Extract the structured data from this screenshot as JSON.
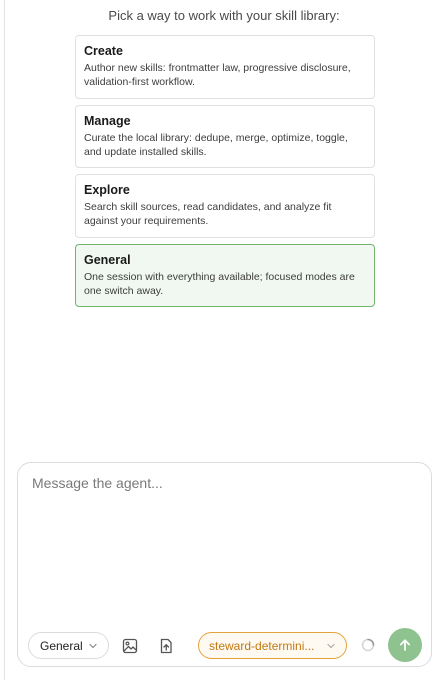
{
  "prompt": "Pick a way to work with your skill library:",
  "modes": [
    {
      "title": "Create",
      "description": "Author new skills: frontmatter law, progressive disclosure, validation-first workflow."
    },
    {
      "title": "Manage",
      "description": "Curate the local library: dedupe, merge, optimize, toggle, and update installed skills."
    },
    {
      "title": "Explore",
      "description": "Search skill sources, read candidates, and analyze fit against your requirements."
    },
    {
      "title": "General",
      "description": "One session with everything available; focused modes are one switch away."
    }
  ],
  "selected_mode": "General",
  "composer": {
    "placeholder": "Message the agent...",
    "value": "",
    "mode_label": "General",
    "model_label": "steward-determini..."
  },
  "icons": {
    "mode_chevron": "chevron-down-icon",
    "image": "image-icon",
    "upload": "file-upload-icon",
    "model_chevron": "chevron-down-icon",
    "spinner": "loading-spinner-icon",
    "send": "arrow-up-icon"
  },
  "colors": {
    "accent_green": "#8ec28e",
    "selected_card_bg": "#f1f8f1",
    "selected_card_border": "#6fb56f",
    "model_accent": "#e2a33a",
    "model_text": "#c27812"
  }
}
